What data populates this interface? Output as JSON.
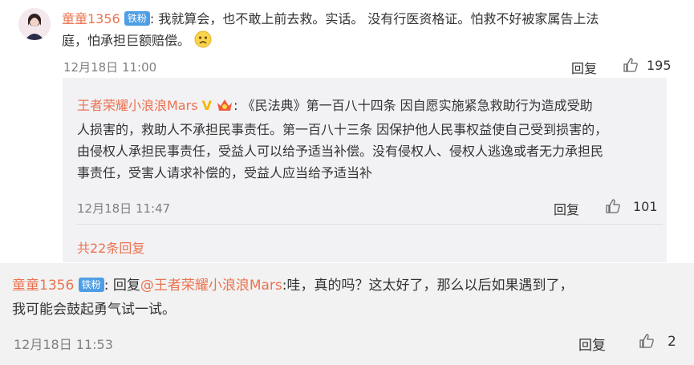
{
  "comment1": {
    "username": "童童1356",
    "badge": "铁粉",
    "colon": ":",
    "text_line1": "我就算会，也不敢上前去救。实话。 没有行医资格证。怕救不好被家属告上法",
    "text_line2": "庭，怕承担巨额赔偿。",
    "emoji": "sad-face-emoji",
    "timestamp": "12月18日 11:00",
    "reply_label": "回复",
    "like_count": "195"
  },
  "reply1": {
    "username": "王者荣耀小浪浪Mars",
    "v_badge": "V",
    "colon": ":",
    "lines": [
      "《民法典》第一百八十四条 因自愿实施紧急救助行为造成受助",
      "人损害的，救助人不承担民事责任。第一百八十三条 因保护他人民事权益使自己受到损害的，",
      "由侵权人承担民事责任，受益人可以给予适当补偿。没有侵权人、侵权人逃逸或者无力承担民",
      "事责任，受害人请求补偿的，受益人应当给予适当补"
    ],
    "timestamp": "12月18日 11:47",
    "reply_label": "回复",
    "like_count": "101"
  },
  "more_replies": "共22条回复",
  "comment2": {
    "username": "童童1356",
    "badge": "铁粉",
    "colon": ":",
    "reply_prefix": "回复",
    "mention": "@王者荣耀小浪浪Mars",
    "text_line1_rest": ":哇，真的吗？这太好了，那么以后如果遇到了，",
    "text_line2": "我可能会鼓起勇气试一试。",
    "timestamp": "12月18日 11:53",
    "reply_label": "回复",
    "like_count": "2"
  },
  "colors": {
    "username": "#eb7350",
    "badge_bg": "#4e9ee5",
    "nested_bg": "#f2f2f5",
    "meta": "#808080"
  }
}
